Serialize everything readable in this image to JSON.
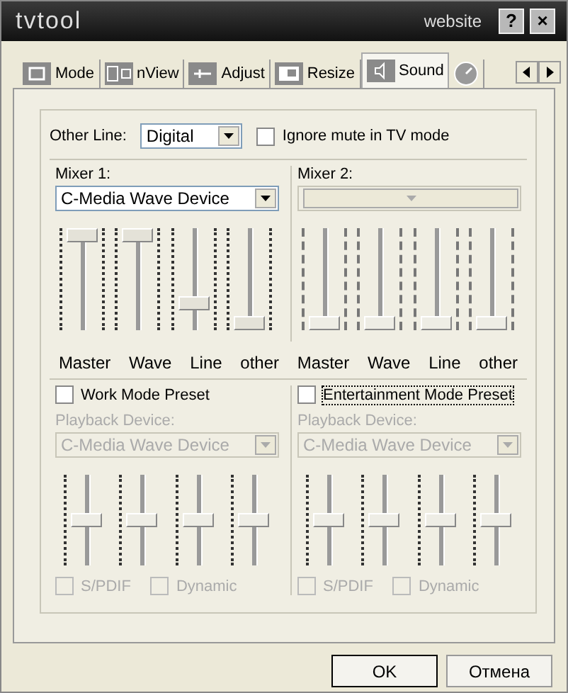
{
  "window": {
    "title": "tvtool",
    "link": "website",
    "help": "?",
    "close": "×"
  },
  "tabs": [
    {
      "label": "Mode",
      "selected": false
    },
    {
      "label": "nView",
      "selected": false
    },
    {
      "label": "Adjust",
      "selected": false
    },
    {
      "label": "Resize",
      "selected": false
    },
    {
      "label": "Sound",
      "selected": true
    },
    {
      "selected": false
    }
  ],
  "other_line": {
    "label": "Other Line:",
    "value": "Digital"
  },
  "ignore_mute": {
    "label": "Ignore mute in TV mode",
    "checked": false
  },
  "mixers": [
    {
      "label": "Mixer 1:",
      "device": "C-Media Wave Device",
      "disabled": false,
      "sliders": [
        {
          "label": "Master",
          "level": 1
        },
        {
          "label": "Wave",
          "level": 1
        },
        {
          "label": "Line",
          "level": 0.22
        },
        {
          "label": "other",
          "level": 0
        }
      ]
    },
    {
      "label": "Mixer 2:",
      "disabled": true,
      "sliders": [
        {
          "label": "Master",
          "level": 0
        },
        {
          "label": "Wave",
          "level": 0
        },
        {
          "label": "Line",
          "level": 0
        },
        {
          "label": "other",
          "level": 0
        }
      ]
    }
  ],
  "presets": [
    {
      "label": "Work Mode Preset",
      "checked": false,
      "focused": false,
      "device_label": "Playback Device:",
      "device": "C-Media Wave Device",
      "disabled": true,
      "levels": [
        {
          "level": 0.5
        },
        {
          "level": 0.5
        },
        {
          "level": 0.5
        },
        {
          "level": 0.5
        }
      ],
      "options": [
        {
          "label": "S/PDIF",
          "checked": false
        },
        {
          "label": "Dynamic",
          "checked": false
        }
      ]
    },
    {
      "label": "Entertainment Mode Preset",
      "checked": false,
      "focused": true,
      "device_label": "Playback Device:",
      "device": "C-Media Wave Device",
      "disabled": true,
      "levels": [
        {
          "level": 0.5
        },
        {
          "level": 0.5
        },
        {
          "level": 0.5
        },
        {
          "level": 0.5
        }
      ],
      "options": [
        {
          "label": "S/PDIF",
          "checked": false
        },
        {
          "label": "Dynamic",
          "checked": false
        }
      ]
    }
  ],
  "buttons": [
    {
      "label": "OK",
      "default": true
    },
    {
      "label": "Отмена",
      "default": false
    }
  ]
}
